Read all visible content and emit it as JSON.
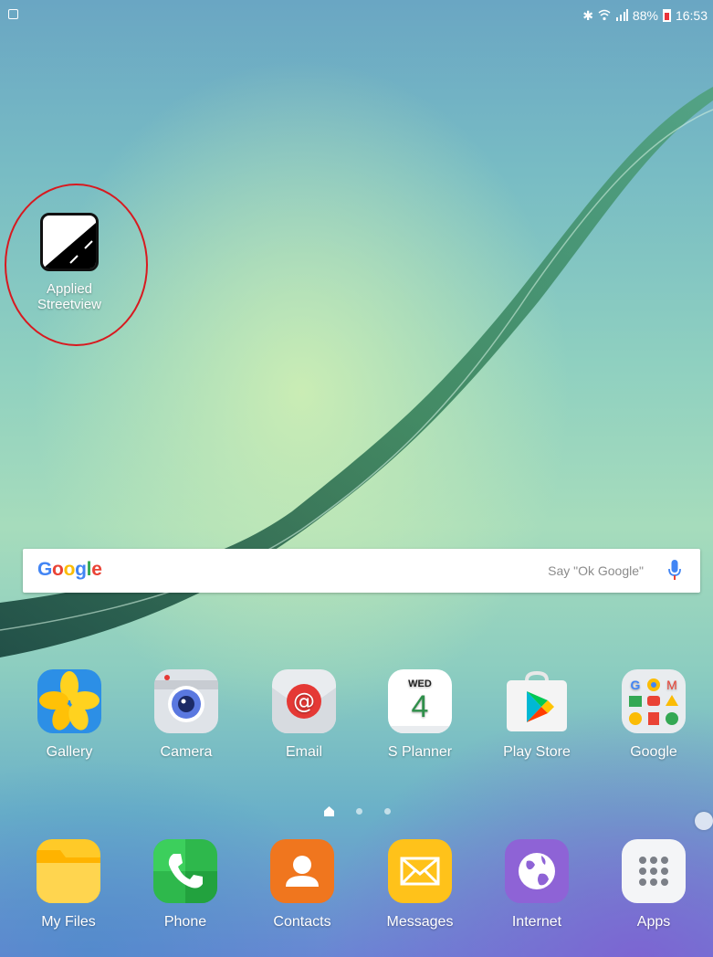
{
  "status_bar": {
    "battery": "88%",
    "time": "16:53",
    "icons": [
      "screenshot-icon",
      "bluetooth-icon",
      "wifi-icon",
      "signal-icon",
      "battery-icon"
    ]
  },
  "desktop_shortcut": {
    "label_line1": "Applied",
    "label_line2": "Streetview",
    "icon": "applied-streetview-icon"
  },
  "search": {
    "logo_letters": [
      "G",
      "o",
      "o",
      "g",
      "l",
      "e"
    ],
    "logo_colors": [
      "#4285F4",
      "#EA4335",
      "#FBBC05",
      "#4285F4",
      "#34A853",
      "#EA4335"
    ],
    "hint": "Say \"Ok Google\"",
    "icon": "microphone-icon"
  },
  "home_apps": [
    {
      "label": "Gallery",
      "icon": "gallery-icon"
    },
    {
      "label": "Camera",
      "icon": "camera-icon"
    },
    {
      "label": "Email",
      "icon": "email-icon"
    },
    {
      "label": "S Planner",
      "icon": "calendar-icon",
      "day": "WED",
      "date": "4"
    },
    {
      "label": "Play Store",
      "icon": "play-store-icon"
    },
    {
      "label": "Google",
      "icon": "google-folder-icon"
    }
  ],
  "page_indicator": {
    "pages": 3,
    "current": 0
  },
  "dock_apps": [
    {
      "label": "My Files",
      "icon": "folder-icon"
    },
    {
      "label": "Phone",
      "icon": "phone-icon"
    },
    {
      "label": "Contacts",
      "icon": "contacts-icon"
    },
    {
      "label": "Messages",
      "icon": "messages-icon"
    },
    {
      "label": "Internet",
      "icon": "internet-icon"
    },
    {
      "label": "Apps",
      "icon": "apps-grid-icon"
    }
  ],
  "colors": {
    "annotation": "#d8191f",
    "mic": "#4285F4"
  }
}
